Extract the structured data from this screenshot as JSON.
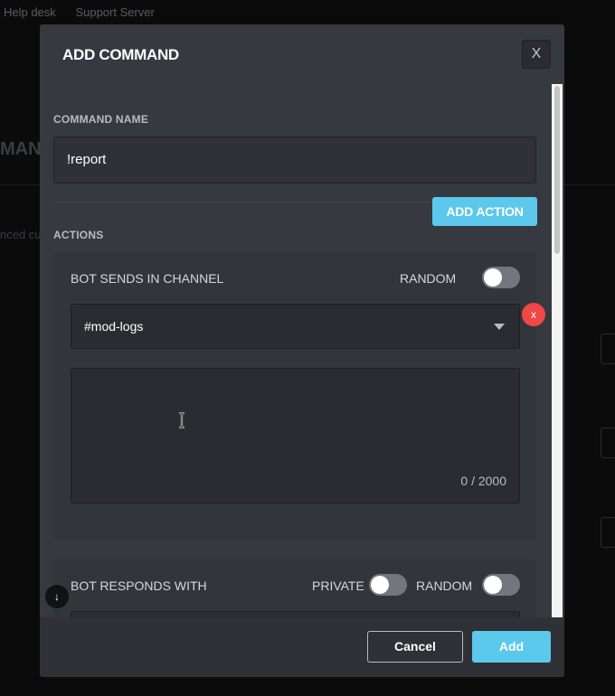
{
  "background": {
    "nav": [
      "Help desk",
      "Support Server"
    ],
    "title_fragment": "MAND",
    "subtitle_fragment": "nced cu"
  },
  "modal": {
    "title": "ADD COMMAND",
    "close_label": "X",
    "command_name_label": "COMMAND NAME",
    "command_name_value": "!report",
    "actions_label": "ACTIONS",
    "add_action_label": "ADD ACTION",
    "action_cards": [
      {
        "title": "BOT SENDS IN CHANNEL",
        "random_label": "RANDOM",
        "random_on": false,
        "remove_label": "x",
        "channel": "#mod-logs",
        "message": "",
        "char_count": "0 / 2000"
      },
      {
        "title": "BOT RESPONDS WITH",
        "private_label": "PRIVATE",
        "private_on": false,
        "random_label": "RANDOM",
        "random_on": false
      }
    ],
    "footer": {
      "cancel_label": "Cancel",
      "add_label": "Add"
    }
  },
  "colors": {
    "accent": "#5bc8ec",
    "danger": "#f04747",
    "modal_bg": "#36393f"
  }
}
